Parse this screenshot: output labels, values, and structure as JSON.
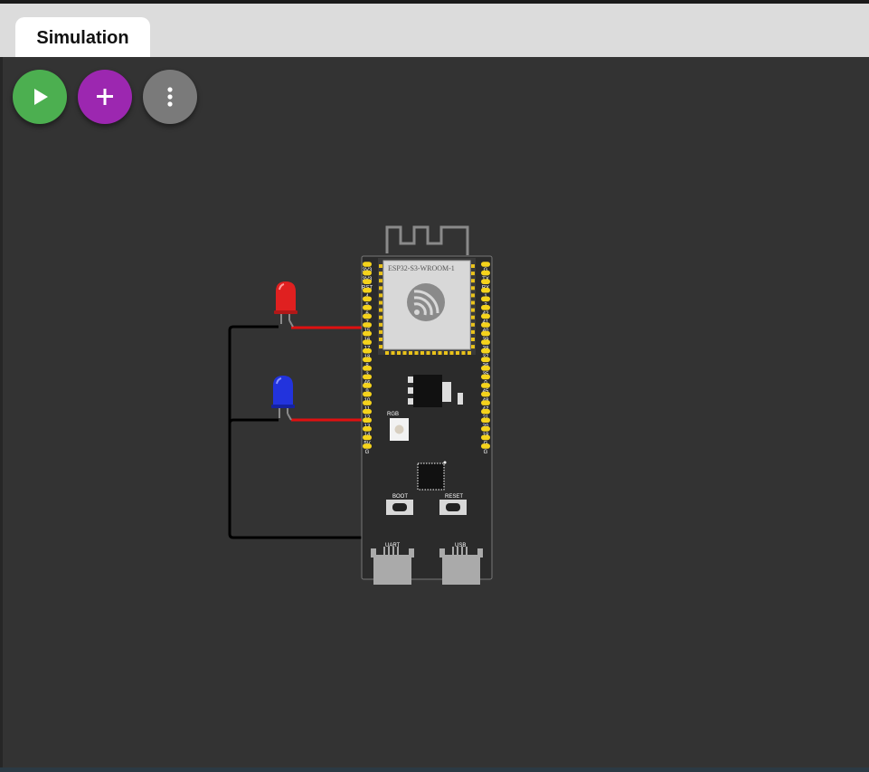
{
  "tabs": [
    {
      "label": "Simulation",
      "active": true
    }
  ],
  "toolbar": {
    "play": {
      "icon": "play-icon",
      "color": "#4caf50"
    },
    "add": {
      "icon": "plus-icon",
      "color": "#9c27b0"
    },
    "more": {
      "icon": "more-vertical-icon",
      "color": "#7a7a7a"
    }
  },
  "board": {
    "module_label": "ESP32-S3-WROOM-1",
    "left_pins": [
      "3V3",
      "3V3",
      "RST",
      "4",
      "5",
      "6",
      "7",
      "15",
      "16",
      "17",
      "18",
      "8",
      "3",
      "46",
      "9",
      "10",
      "11",
      "12",
      "13",
      "14",
      "5V",
      "G"
    ],
    "right_pins": [
      "G",
      "TX",
      "RX",
      "1",
      "2",
      "42",
      "41",
      "40",
      "39",
      "38",
      "37",
      "36",
      "35",
      "0",
      "45",
      "48",
      "47",
      "21",
      "20",
      "19",
      "G",
      "G"
    ],
    "rgb_label": "RGB",
    "boot_label": "BOOT",
    "reset_label": "RESET",
    "uart_label": "UART",
    "usb_label": "USB"
  },
  "components": [
    {
      "name": "red-led",
      "color": "#e02020"
    },
    {
      "name": "blue-led",
      "color": "#2233dd"
    }
  ],
  "wire_colors": {
    "signal": "#e01010",
    "ground": "#000000"
  }
}
